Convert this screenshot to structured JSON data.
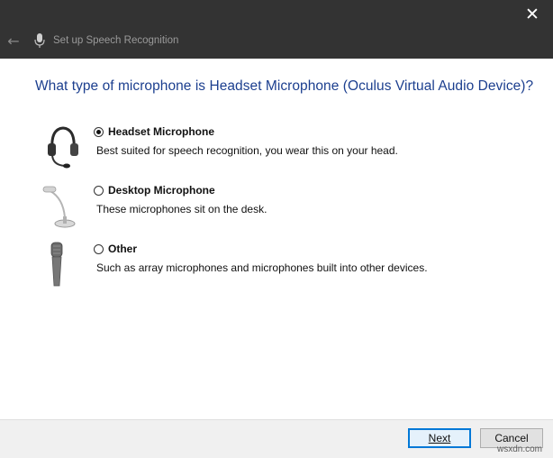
{
  "window": {
    "title": "Set up Speech Recognition",
    "close_icon": "close-icon",
    "back_icon": "back-arrow-icon"
  },
  "question": "What type of microphone is Headset Microphone (Oculus Virtual Audio Device)?",
  "options": [
    {
      "label": "Headset Microphone",
      "description": "Best suited for speech recognition, you wear this on your head.",
      "selected": true,
      "icon": "headset-icon"
    },
    {
      "label": "Desktop Microphone",
      "description": "These microphones sit on the desk.",
      "selected": false,
      "icon": "desktop-microphone-icon"
    },
    {
      "label": "Other",
      "description": "Such as array microphones and microphones built into other devices.",
      "selected": false,
      "icon": "handheld-microphone-icon"
    }
  ],
  "buttons": {
    "next": "Next",
    "cancel": "Cancel"
  },
  "watermark": "wsxdn.com",
  "colors": {
    "titlebar": "#333333",
    "question_text": "#1c3f8f",
    "primary_button_border": "#0078d7"
  }
}
